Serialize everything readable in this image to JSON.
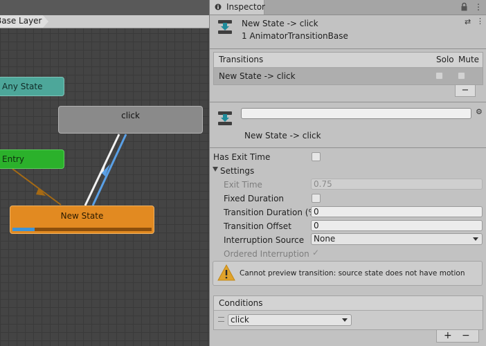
{
  "graph": {
    "breadcrumb": "Base Layer",
    "nodes": {
      "any_state": "Any State",
      "click": "click",
      "entry": "Entry",
      "new_state": "New State"
    },
    "new_state_progress": 0.16,
    "colors": {
      "any_state": "#4da79a",
      "entry": "#2bb12b",
      "new_state": "#e28a21",
      "click": "#8a8a8a",
      "selected_transition": "#5aa0e6"
    }
  },
  "inspector": {
    "tab_label": "Inspector",
    "header": {
      "title": "New State -> click",
      "subtitle": "1 AnimatorTransitionBase"
    },
    "transitions": {
      "col_name": "Transitions",
      "col_solo": "Solo",
      "col_mute": "Mute",
      "rows": [
        {
          "name": "New State -> click",
          "solo": false,
          "mute": false
        }
      ],
      "remove_label": "−"
    },
    "transition_header": {
      "name_value": "",
      "title": "New State -> click"
    },
    "has_exit_time_label": "Has Exit Time",
    "settings_label": "Settings",
    "exit_time_label": "Exit Time",
    "exit_time_value": "0.75",
    "fixed_duration_label": "Fixed Duration",
    "transition_duration_label": "Transition Duration (%",
    "transition_duration_value": "0",
    "transition_offset_label": "Transition Offset",
    "transition_offset_value": "0",
    "interruption_source_label": "Interruption Source",
    "interruption_source_value": "None",
    "ordered_interruption_label": "Ordered Interruption",
    "warning": "Cannot preview transition: source state does not have motion",
    "conditions": {
      "title": "Conditions",
      "items": [
        {
          "parameter": "click"
        }
      ],
      "add_label": "+",
      "remove_label": "−"
    }
  }
}
